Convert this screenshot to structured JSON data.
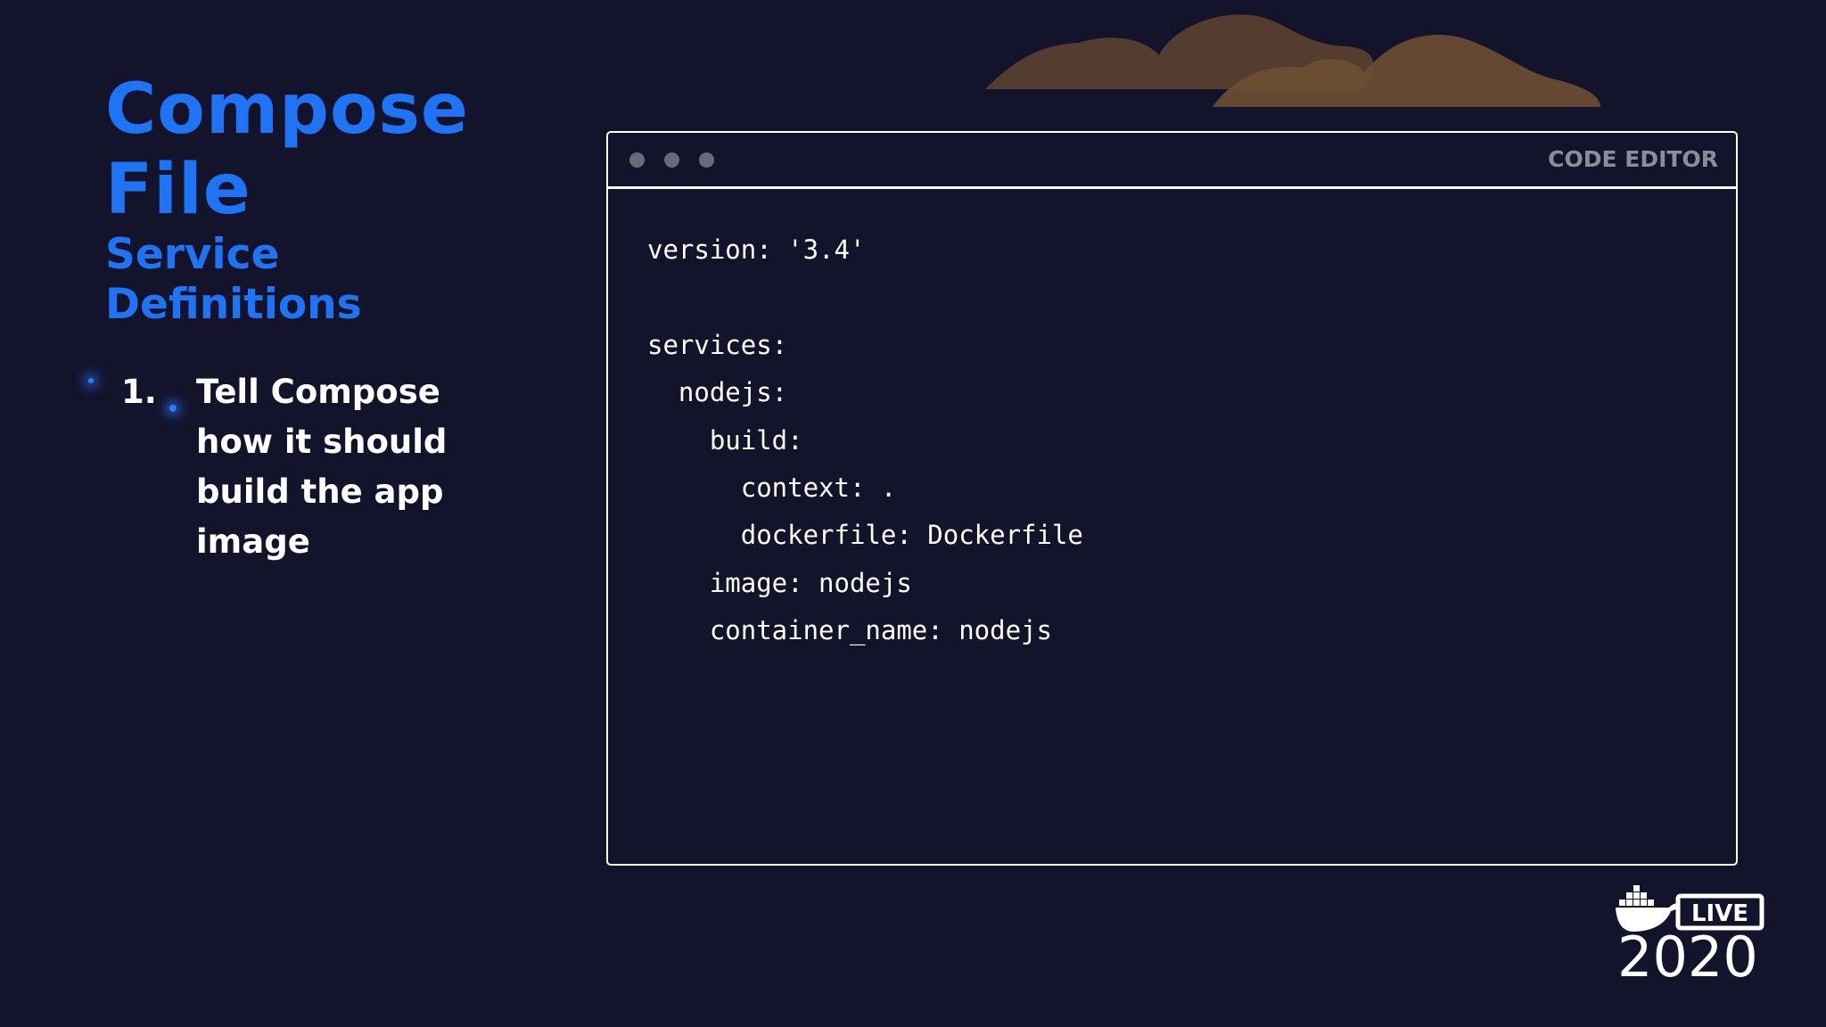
{
  "slide": {
    "title_line1": "Compose",
    "title_line2": "File",
    "subtitle_line1": "Service",
    "subtitle_line2": "Definitions",
    "step_number": "1.",
    "step_text": "Tell Compose how it should build the app image"
  },
  "editor": {
    "label": "CODE EDITOR",
    "code": "version: '3.4'\n\nservices:\n  nodejs:\n    build:\n      context: .\n      dockerfile: Dockerfile\n    image: nodejs\n    container_name: nodejs"
  },
  "logo": {
    "badge": "LIVE",
    "year": "2020"
  },
  "colors": {
    "background": "#14132c",
    "accent_blue": "#1f74f5",
    "text": "#ffffff",
    "muted": "#8d8c9b",
    "cloud": "#6e4f33"
  },
  "icons": {
    "logo": "docker-whale-icon",
    "decoration": "clouds"
  }
}
